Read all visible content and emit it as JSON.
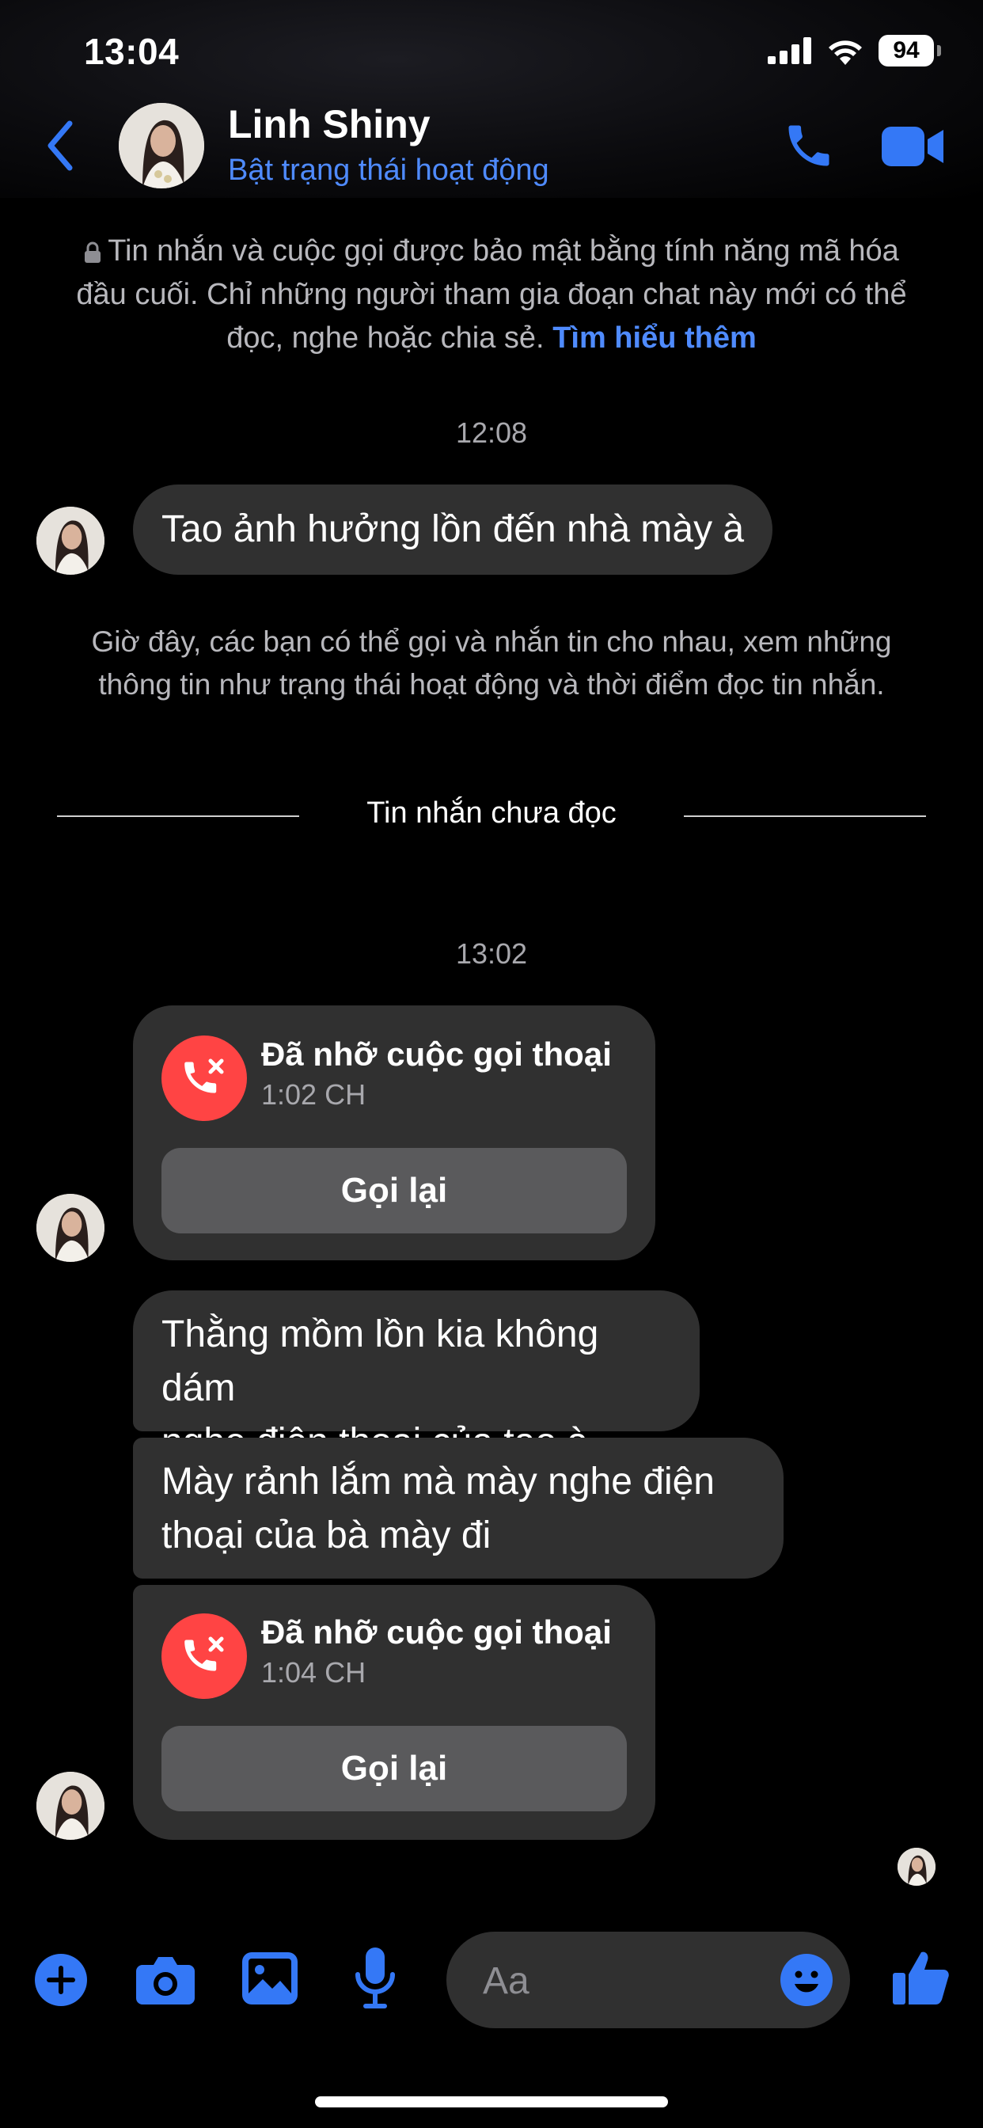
{
  "status_bar": {
    "time": "13:04",
    "battery": "94"
  },
  "header": {
    "contact_name": "Linh Shiny",
    "contact_status": "Bật trạng thái hoạt động"
  },
  "e2ee_notice": {
    "line1": "Tin nhắn và cuộc gọi được bảo mật bằng tính năng mã hóa",
    "line2": "đầu cuối. Chỉ những người tham gia đoạn chat này mới có thể",
    "line3": "đọc, nghe hoặc chia sẻ.",
    "link": "Tìm hiểu thêm"
  },
  "messages": {
    "time_1": "12:08",
    "msg_1": "Tao ảnh hưởng lồn đến nhà mày à",
    "info_line1": "Giờ đây, các bạn có thể gọi và nhắn tin cho nhau, xem những",
    "info_line2": "thông tin như trạng thái hoạt động và thời điểm đọc tin nhắn.",
    "unread_divider": "Tin nhắn chưa đọc",
    "time_2": "13:02",
    "call_1": {
      "title": "Đã nhỡ cuộc gọi thoại",
      "time": "1:02 CH",
      "button": "Gọi lại"
    },
    "msg_2_line1": "Thằng mồm lồn kia không dám",
    "msg_2_line2": "nghe điện thoại của tao à",
    "msg_3_line1": "Mày rảnh lắm mà mày nghe điện",
    "msg_3_line2": "thoại của bà mày đi",
    "call_2": {
      "title": "Đã nhỡ cuộc gọi thoại",
      "time": "1:04 CH",
      "button": "Gọi lại"
    }
  },
  "composer": {
    "placeholder": "Aa"
  },
  "colors": {
    "accent": "#4f8bff",
    "bubble": "#303030",
    "missed_call": "#ff4444"
  }
}
